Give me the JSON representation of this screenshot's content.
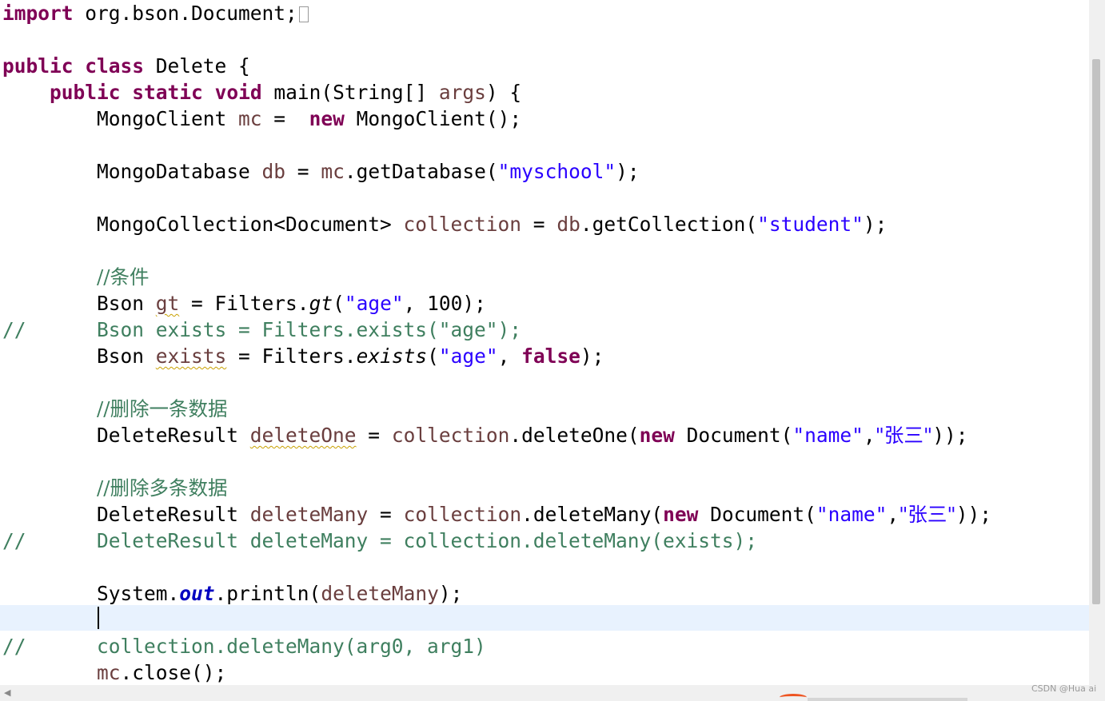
{
  "code": {
    "l1": {
      "kw": "import",
      "rest": " org.bson.Document;"
    },
    "l3": {
      "kw1": "public",
      "kw2": "class",
      "rest": " Delete {"
    },
    "l4": {
      "kw1": "public",
      "kw2": "static",
      "kw3": "void",
      "pre": " main(String[] ",
      "var": "args",
      "post": ") {"
    },
    "l5": {
      "type": "MongoClient ",
      "var": "mc",
      "eq": " =  ",
      "kw": "new",
      "rest": " MongoClient();"
    },
    "l7": {
      "type": "MongoDatabase ",
      "var": "db",
      "eq": " = ",
      "var2": "mc",
      "mid": ".getDatabase(",
      "str": "\"myschool\"",
      "post": ");"
    },
    "l9": {
      "type": "MongoCollection<Document> ",
      "var": "collection",
      "eq": " = ",
      "var2": "db",
      "mid": ".getCollection(",
      "str": "\"student\"",
      "post": ");"
    },
    "l11": {
      "comment": "//条件"
    },
    "l12": {
      "type": "Bson ",
      "var": "gt",
      "eq": " = Filters.",
      "method": "gt",
      "open": "(",
      "str": "\"age\"",
      "post": ", 100);"
    },
    "l13": {
      "prefix": "//",
      "comment": "Bson exists = Filters.exists(\"age\");"
    },
    "l14": {
      "type": "Bson ",
      "var": "exists",
      "eq": " = Filters.",
      "method": "exists",
      "open": "(",
      "str": "\"age\"",
      "mid": ", ",
      "kw": "false",
      "post": ");"
    },
    "l16": {
      "comment": "//删除一条数据"
    },
    "l17": {
      "type": "DeleteResult ",
      "var": "deleteOne",
      "eq": " = ",
      "var2": "collection",
      "mid": ".deleteOne(",
      "kw": "new",
      "mid2": " Document(",
      "str1": "\"name\"",
      "comma": ",",
      "str2": "\"张三\"",
      "post": "));"
    },
    "l19": {
      "comment": "//删除多条数据"
    },
    "l20": {
      "type": "DeleteResult ",
      "var": "deleteMany",
      "eq": " = ",
      "var2": "collection",
      "mid": ".deleteMany(",
      "kw": "new",
      "mid2": " Document(",
      "str1": "\"name\"",
      "comma": ",",
      "str2": "\"张三\"",
      "post": "));"
    },
    "l21": {
      "prefix": "//",
      "comment": "DeleteResult deleteMany = collection.deleteMany(exists);"
    },
    "l23": {
      "pre": "System.",
      "field": "out",
      "mid": ".println(",
      "var": "deleteMany",
      "post": ");"
    },
    "l25": {
      "prefix": "//",
      "comment": "collection.deleteMany(arg0, arg1)"
    },
    "l26": {
      "var": "mc",
      "post": ".close();"
    }
  },
  "colors": {
    "keyword": "#7f0055",
    "string": "#2a00ff",
    "variable": "#6a3e3e",
    "comment": "#3f7f5f",
    "field": "#0000c0",
    "current_line": "#e8f2fe"
  },
  "scrollbar": {
    "left_arrow": "◀"
  },
  "watermark": "CSDN @Hua ai"
}
